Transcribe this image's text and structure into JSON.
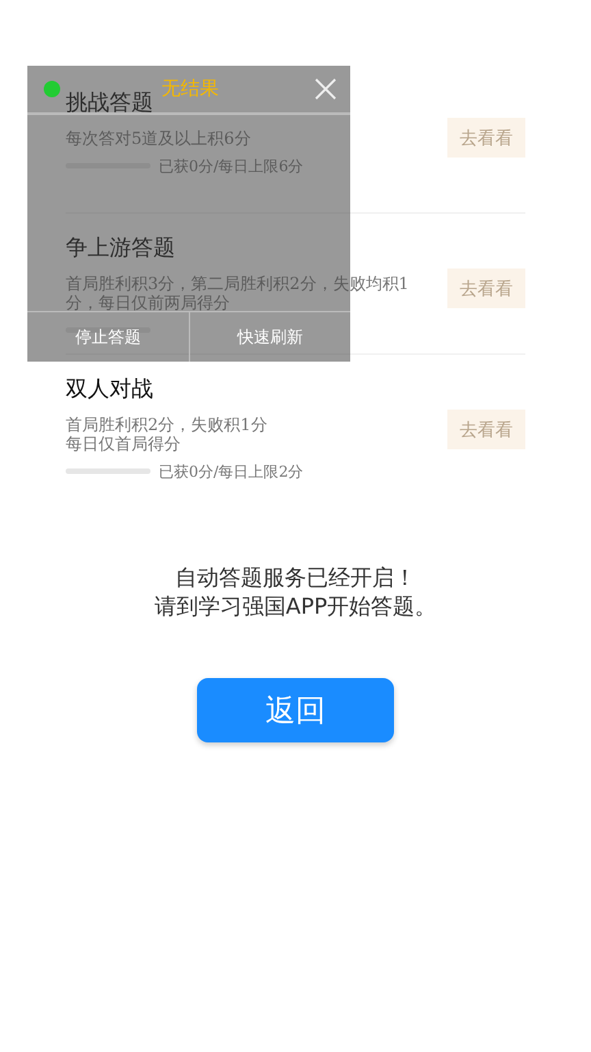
{
  "tasks": [
    {
      "title": "挑战答题",
      "description": [
        "每次答对5道及以上积6分"
      ],
      "level": 0,
      "progress": "已获0分/每日上限6分",
      "button": "去看看"
    },
    {
      "title": "争上游答题",
      "description": [
        "首局胜利积3分，第二局胜利积2分，失败均积1",
        "分，每日仅前两局得分"
      ],
      "level": 0,
      "button": "去看看"
    },
    {
      "title": "双人对战",
      "description": [
        "首局胜利积2分，失败积1分",
        "每日仅首局得分"
      ],
      "level": 0,
      "progress": "已获0分/每日上限2分",
      "button": "去看看"
    }
  ],
  "overlay": {
    "color": "#22cc33",
    "status": "无结果",
    "buttons": [
      "停止答题",
      "快速刷新"
    ]
  },
  "message": [
    "自动答题服务已经开启！",
    "请到学习强国APP开始答题。"
  ],
  "return_button": "返回"
}
